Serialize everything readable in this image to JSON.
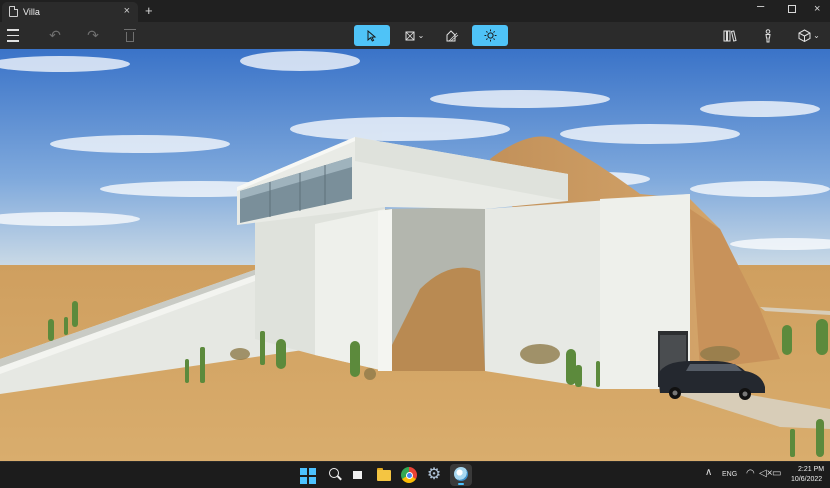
{
  "tab": {
    "title": "Villa",
    "close": "×",
    "new_tab": "+"
  },
  "window_controls": {
    "minimize": "–",
    "close": "×"
  },
  "toolbar": {
    "menu_icon": "hamburger-menu-icon",
    "undo_glyph": "↶",
    "redo_glyph": "↷",
    "select_glyph": "⇖",
    "create_glyph": "⧉",
    "plan_glyph": "⌂",
    "sun_glyph": "☼",
    "library_glyph": "Ⅲ",
    "figure_glyph": "♙",
    "view_glyph": "⬡",
    "caret": "⌄",
    "accent_color": "#4fc3f7"
  },
  "scene": {
    "description_icon": "3d-villa-viewport",
    "sky_color": "#3f7ad0",
    "ground_color": "#d4a867"
  },
  "taskbar": {
    "settings_glyph": "⚙",
    "tray_chevron": "∧",
    "language": "ENG",
    "wifi_glyph": "◠",
    "volume_glyph": "◁×",
    "battery_glyph": "▭",
    "time": "2:21 PM",
    "date": "10/6/2022"
  }
}
